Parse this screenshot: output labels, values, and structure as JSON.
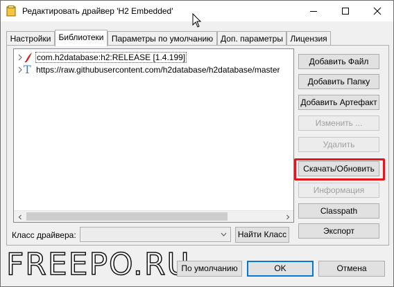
{
  "window": {
    "title": "Редактировать драйвер 'H2 Embedded'",
    "minimize_glyph": "—",
    "maximize_glyph": "☐",
    "close_glyph": "✕"
  },
  "tabs": [
    {
      "label": "Настройки",
      "active": false
    },
    {
      "label": "Библиотеки",
      "active": true
    },
    {
      "label": "Параметры по умолчанию",
      "active": false
    },
    {
      "label": "Доп. параметры",
      "active": false
    },
    {
      "label": "Лицензия",
      "active": false
    }
  ],
  "libraries": [
    {
      "label": "com.h2database:h2:RELEASE [1.4.199]",
      "icon": "maven-icon",
      "selected": true
    },
    {
      "label": "https://raw.githubusercontent.com/h2database/h2database/master",
      "icon": "text-file-icon",
      "selected": false
    }
  ],
  "side_buttons": {
    "add_file": "Добавить Файл",
    "add_folder": "Добавить Папку",
    "add_artifact": "Добавить Артефакт",
    "edit": "Изменить ...",
    "delete": "Удалить",
    "download_update": "Скачать/Обновить",
    "info": "Информация",
    "classpath": "Classpath",
    "export": "Экспорт"
  },
  "driver_class": {
    "label": "Класс драйвера:",
    "value": "",
    "find_button": "Найти Класс"
  },
  "footer": {
    "defaults_button": "По умолчанию",
    "ok_button": "OK",
    "cancel_button": "Отмена"
  },
  "watermark": "FREEPO.RU",
  "colors": {
    "highlight": "#e3171c",
    "default_button_border": "#0078d7"
  }
}
